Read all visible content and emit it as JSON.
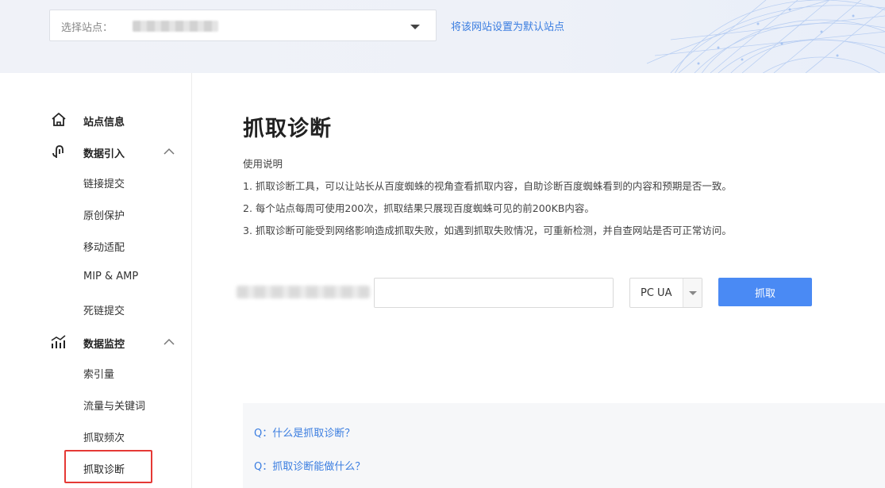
{
  "header": {
    "site_select_label": "选择站点：",
    "set_default_link": "将该网站设置为默认站点"
  },
  "sidebar": {
    "groups": [
      {
        "label": "站点信息",
        "icon": "home-icon",
        "expanded": null
      },
      {
        "label": "数据引入",
        "icon": "data-import-icon",
        "expanded": true,
        "items": [
          "链接提交",
          "原创保护",
          "移动适配",
          "MIP & AMP",
          "死链提交"
        ]
      },
      {
        "label": "数据监控",
        "icon": "monitor-chart-icon",
        "expanded": true,
        "items": [
          "索引量",
          "流量与关键词",
          "抓取频次",
          "抓取诊断"
        ]
      }
    ],
    "active_item": "抓取诊断"
  },
  "main": {
    "title": "抓取诊断",
    "usage_heading": "使用说明",
    "usage_lines": [
      "1. 抓取诊断工具，可以让站长从百度蜘蛛的视角查看抓取内容，自助诊断百度蜘蛛看到的内容和预期是否一致。",
      "2. 每个站点每周可使用200次，抓取结果只展现百度蜘蛛可见的前200KB内容。",
      "3. 抓取诊断可能受到网络影响造成抓取失败，如遇到抓取失败情况，可重新检测，并自查网站是否可正常访问。"
    ],
    "url_input_value": "",
    "ua_select_value": "PC UA",
    "fetch_button": "抓取",
    "faq": [
      "Q：什么是抓取诊断？",
      "Q：抓取诊断能做什么？"
    ]
  },
  "colors": {
    "link": "#3a7de0",
    "primary_button": "#4a8af4",
    "active_outline": "#e53935"
  }
}
